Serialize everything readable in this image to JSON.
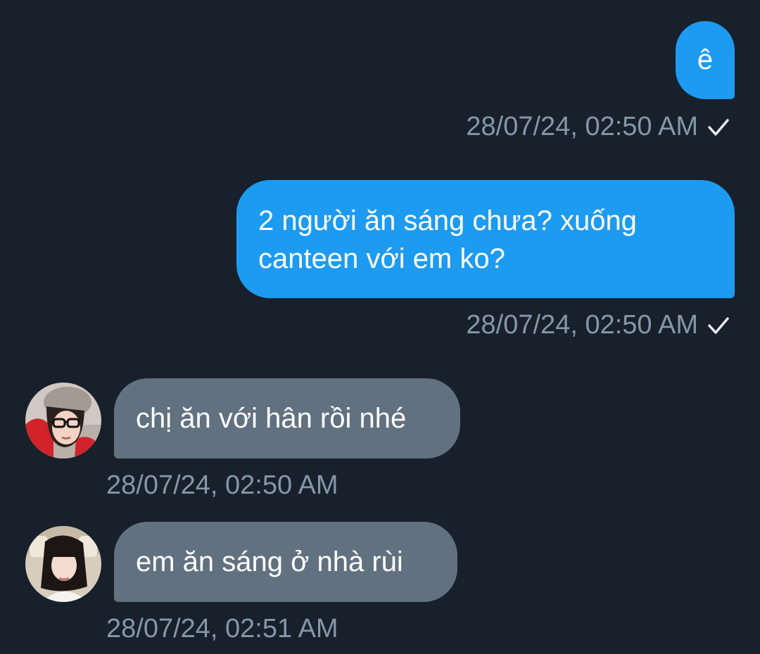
{
  "theme": {
    "background": "#17202b",
    "outgoing_bubble": "#1d9bf0",
    "incoming_bubble": "#627180",
    "timestamp_color": "#8597a8"
  },
  "messages": [
    {
      "direction": "outgoing",
      "text": "ê",
      "timestamp": "28/07/24, 02:50 AM",
      "status_icon": "check-icon"
    },
    {
      "direction": "outgoing",
      "line1": "2 người ăn sáng chưa? xuống",
      "line2": "canteen với em ko?",
      "timestamp": "28/07/24, 02:50 AM",
      "status_icon": "check-icon"
    },
    {
      "direction": "incoming",
      "text": "chị ăn với hân rồi nhé",
      "timestamp": "28/07/24, 02:50 AM",
      "avatar": "avatar-icon"
    },
    {
      "direction": "incoming",
      "text": "em ăn sáng ở nhà rùi",
      "timestamp": "28/07/24, 02:51 AM",
      "avatar": "avatar-icon"
    }
  ]
}
